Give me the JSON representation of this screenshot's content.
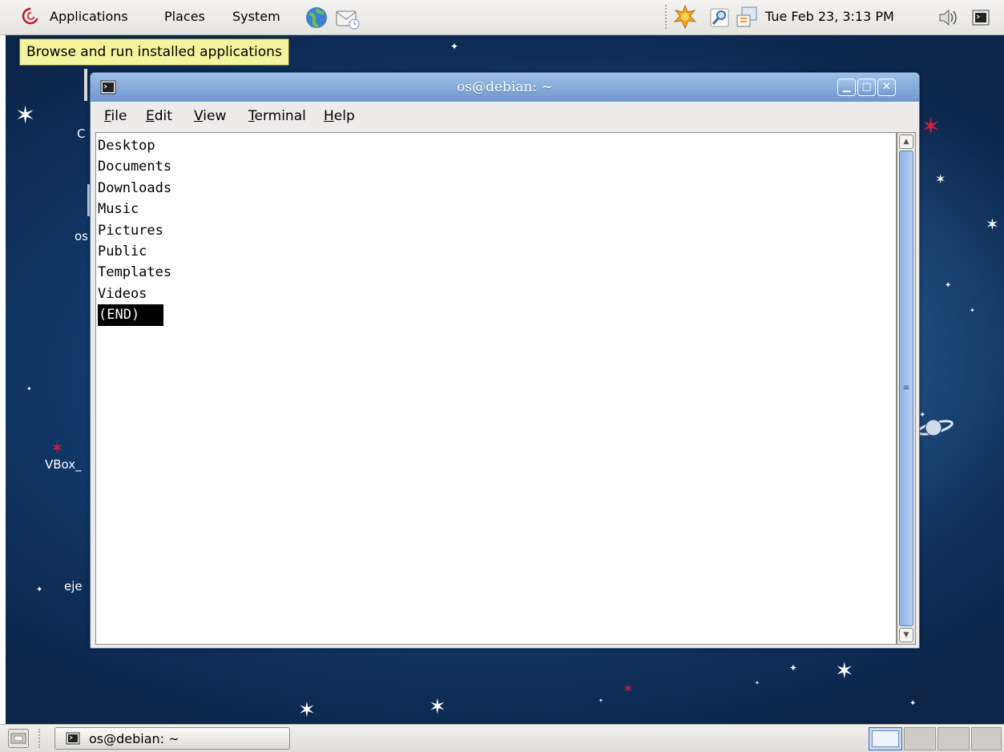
{
  "top_panel": {
    "menus": {
      "applications": "Applications",
      "places": "Places",
      "system": "System"
    },
    "clock": "Tue Feb 23,  3:13 PM",
    "icons": [
      "debian-swirl-icon",
      "web-browser-icon",
      "mail-icon",
      "update-notifier-icon",
      "search-icon",
      "network-icon",
      "volume-icon",
      "terminal-applet-icon"
    ]
  },
  "tooltip": {
    "text": "Browse and run installed applications"
  },
  "desktop": {
    "icon_labels": {
      "computer": "C",
      "home": "os",
      "vbox": "VBox_",
      "eject": "eje"
    }
  },
  "terminal": {
    "title": "os@debian: ~",
    "menu": {
      "file": {
        "mnemonic": "F",
        "rest": "ile"
      },
      "edit": {
        "mnemonic": "E",
        "rest": "dit"
      },
      "view": {
        "mnemonic": "V",
        "rest": "iew"
      },
      "terminal": {
        "mnemonic": "T",
        "rest": "erminal"
      },
      "help": {
        "mnemonic": "H",
        "rest": "elp"
      }
    },
    "lines": [
      "Desktop",
      "Documents",
      "Downloads",
      "Music",
      "Pictures",
      "Public",
      "Templates",
      "Videos"
    ],
    "end_marker": "(END)",
    "scroll_grip": "≡"
  },
  "bottom_panel": {
    "task_label": "os@debian: ~",
    "workspace_count": 4
  }
}
